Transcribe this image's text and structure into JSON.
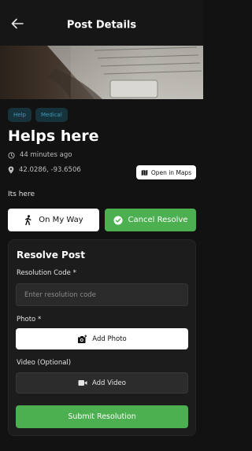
{
  "header": {
    "title": "Post Details",
    "back_icon": "arrow-left-icon"
  },
  "post": {
    "tags": [
      "Help",
      "Medical"
    ],
    "title": "Helps here",
    "time_ago": "44 minutes ago",
    "coordinates": "42.0286, -93.6506",
    "open_maps_label": "Open in Maps",
    "body": "Its here"
  },
  "actions": {
    "on_my_way_label": "On My Way",
    "cancel_resolve_label": "Cancel Resolve"
  },
  "resolve": {
    "title": "Resolve Post",
    "code_label": "Resolution Code *",
    "code_placeholder": "Enter resolution code",
    "code_value": "",
    "photo_label": "Photo *",
    "add_photo_label": "Add Photo",
    "video_label": "Video (Optional)",
    "add_video_label": "Add Video",
    "submit_label": "Submit Resolution"
  },
  "colors": {
    "background": "#121212",
    "card": "#1c1c1c",
    "accent_green": "#4caf50",
    "tag_bg": "#16323b",
    "tag_text": "#3f9bb8"
  }
}
